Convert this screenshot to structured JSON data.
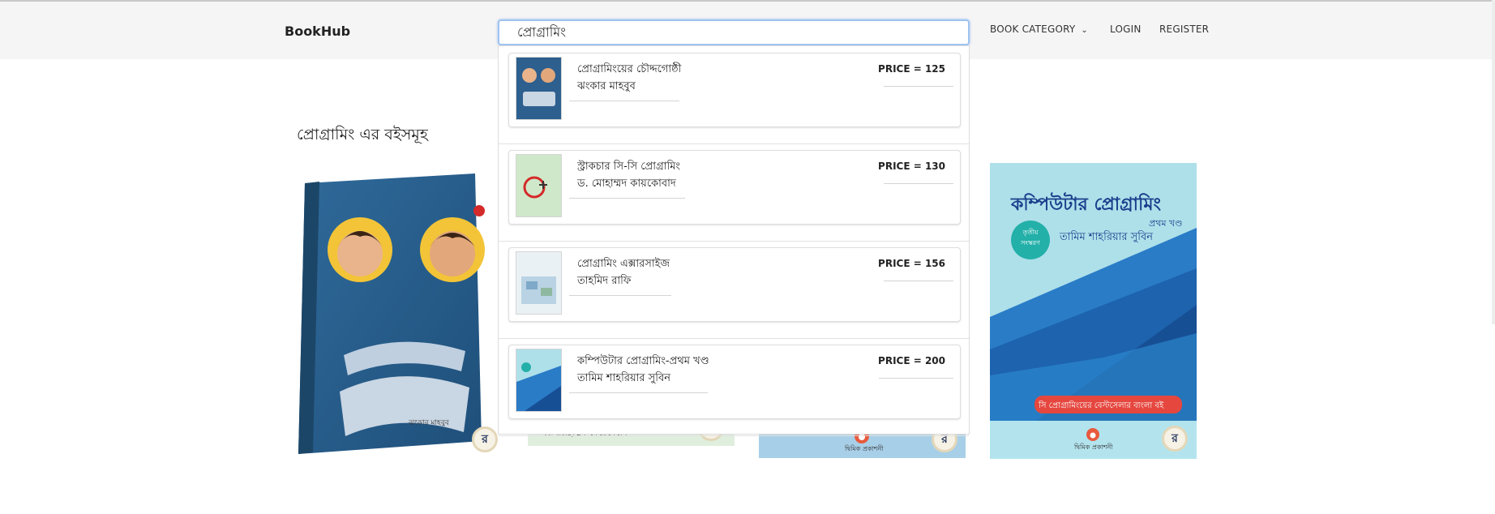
{
  "navbar": {
    "brand": "BookHub",
    "search": {
      "value": "প্রোগ্রামিং",
      "placeholder": ""
    },
    "links": {
      "category": "BOOK CATEGORY",
      "login": "LOGIN",
      "register": "REGISTER"
    }
  },
  "section": {
    "title": "প্রোগ্রামিং এর বইসমূহ"
  },
  "covers": {
    "c1": {
      "title_art": "প্রোগ্রামিংয়ের চৌদ্দগোষ্ঠী",
      "author": "ঝংকার মাহবুব",
      "badge": "র"
    },
    "c2": {
      "fragment": "ড. মোহাম্মদ কায়কোবাদ",
      "badge": "র"
    },
    "c3": {
      "publisher": "দ্বিমিক প্রকাশনী",
      "badge": "র"
    },
    "c4": {
      "title": "কম্পিউটার প্রোগ্রামিং",
      "volume": "প্রথম খণ্ড",
      "edition": "তৃতীয় সংস্করণ",
      "author": "তামিম শাহরিয়ার সুবিন",
      "tagline": "সি প্রোগ্রামিংয়ের বেস্টসেলার বাংলা বই",
      "publisher": "দ্বিমিক প্রকাশনী",
      "badge": "র"
    }
  },
  "suggestions": [
    {
      "title": "প্রোগ্রামিংয়ের চৌদ্দগোষ্ঠী",
      "author": "ঝংকার মাহবুব",
      "price": "PRICE = 125"
    },
    {
      "title": "স্ট্রাকচার সি-সি প্রোগ্রামিং",
      "author": "ড. মোহাম্মদ কায়কোবাদ",
      "price": "PRICE = 130"
    },
    {
      "title": "প্রোগ্রামিং এক্সারসাইজ",
      "author": "তাহমিদ রাফি",
      "price": "PRICE = 156"
    },
    {
      "title": "কম্পিউটার প্রোগ্রামিং-প্রথম খণ্ড",
      "author": "তামিম শাহরিয়ার সুবিন",
      "price": "PRICE = 200"
    }
  ],
  "colors": {
    "accent_focus": "#9ec3f0",
    "navbar_bg": "#f6f5f5"
  },
  "icons": {
    "category_toggle": "chevron-down-icon",
    "cover_badge": "publisher-logo-icon"
  }
}
